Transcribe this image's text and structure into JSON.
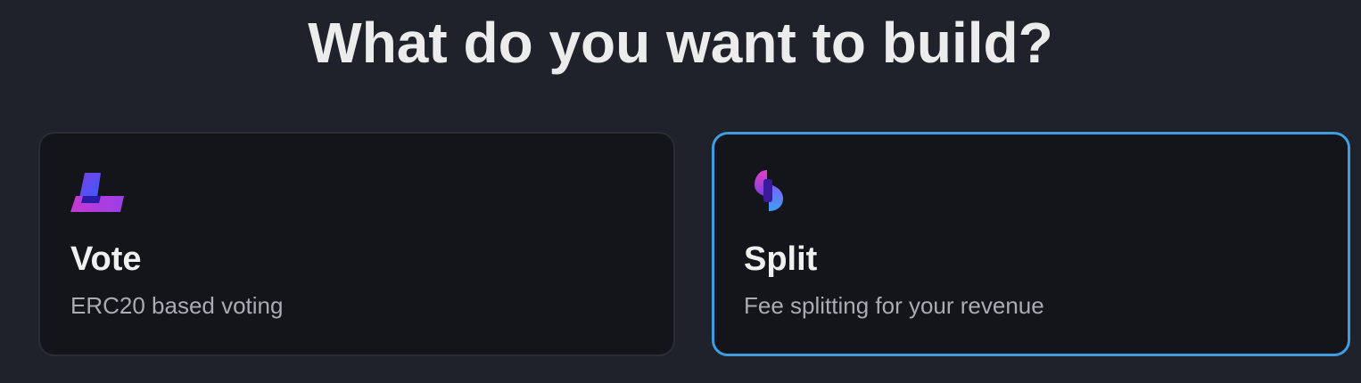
{
  "heading": "What do you want to build?",
  "options": [
    {
      "title": "Vote",
      "description": "ERC20 based voting",
      "icon": "vote-icon",
      "selected": false
    },
    {
      "title": "Split",
      "description": "Fee splitting for your revenue",
      "icon": "split-icon",
      "selected": true
    }
  ],
  "colors": {
    "background": "#1f222b",
    "card_background": "#13151a",
    "selected_border": "#3f9ee0",
    "card_border": "#2a2d35"
  }
}
